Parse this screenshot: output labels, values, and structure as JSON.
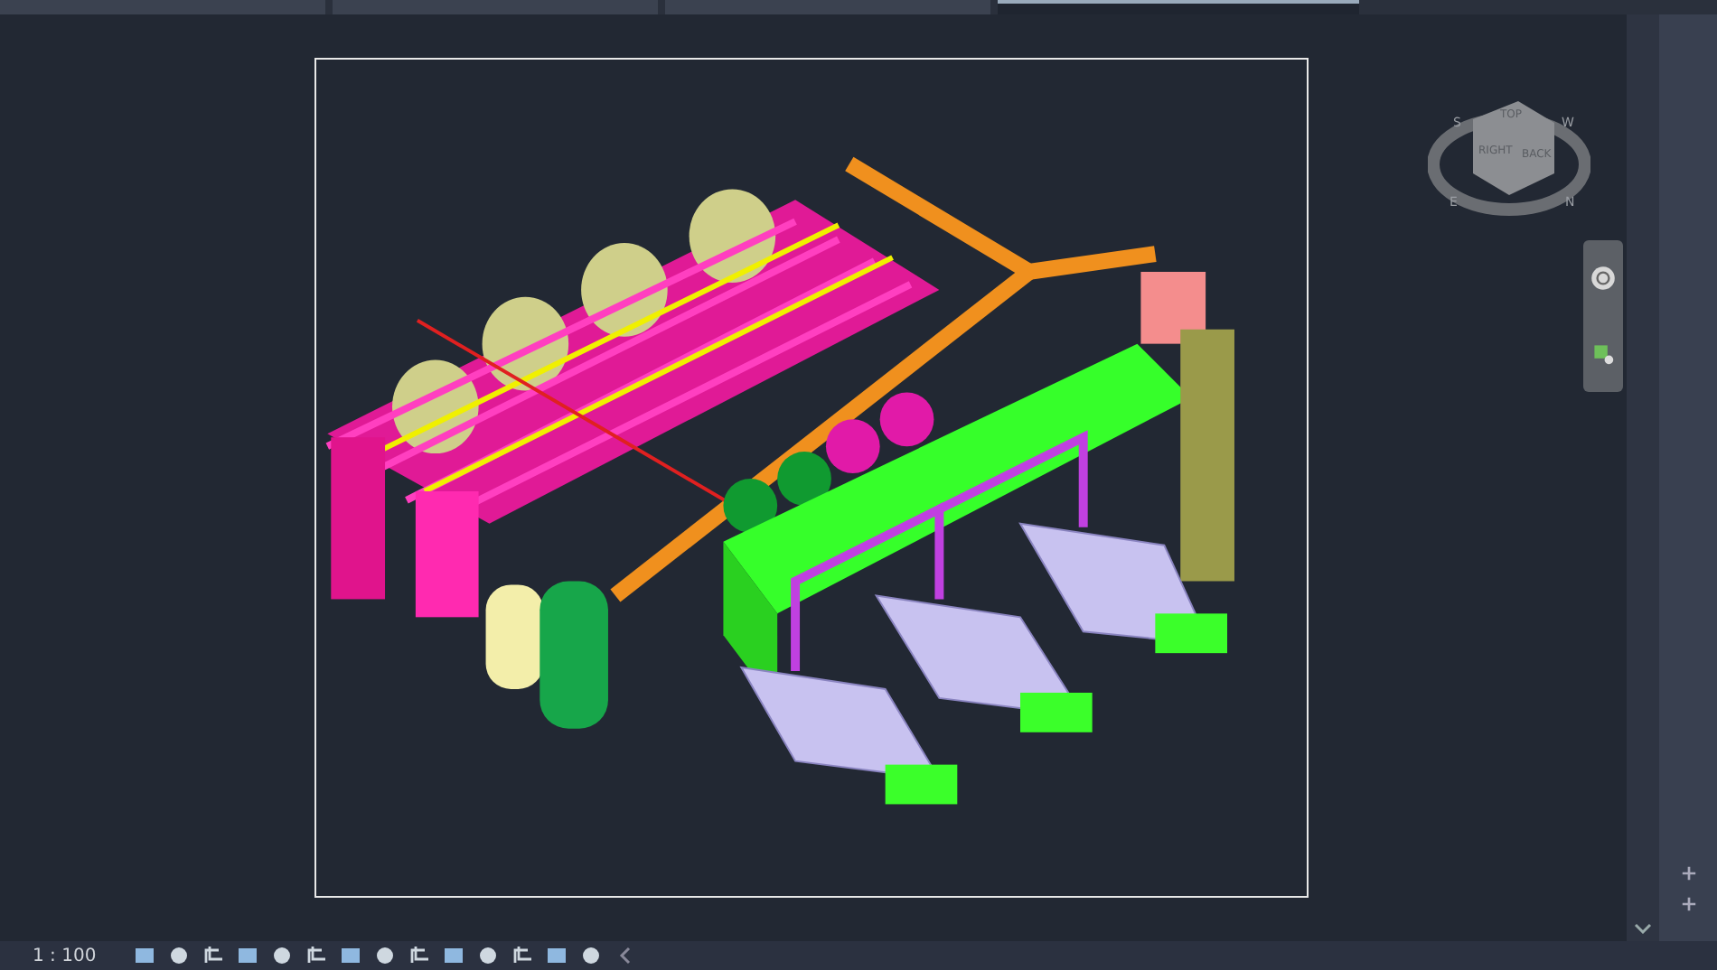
{
  "tabs": [
    {
      "selected": false
    },
    {
      "selected": false
    },
    {
      "selected": false
    },
    {
      "selected": true
    }
  ],
  "view_cube": {
    "faces": [
      "TOP",
      "RIGHT",
      "BACK"
    ],
    "compass": [
      "S",
      "W",
      "E",
      "N"
    ]
  },
  "status_bar": {
    "scale": "1 : 100"
  }
}
